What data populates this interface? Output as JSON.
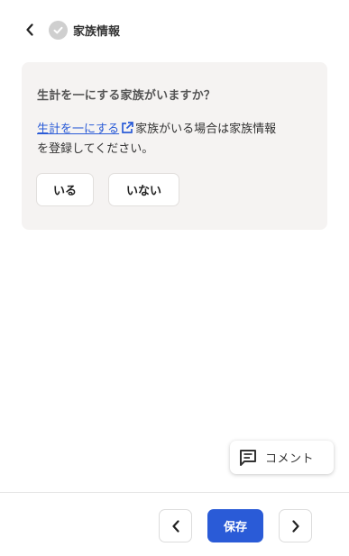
{
  "header": {
    "title": "家族情報",
    "back_icon": "chevron-left-icon",
    "status_icon": "check-circle-icon"
  },
  "card": {
    "question": "生計を一にする家族がいますか？",
    "link_text": "生計を一にする",
    "link_icon": "external-link-icon",
    "desc_line1_rest": "家族がいる場合は家族情報",
    "desc_line2": "を登録してください。",
    "yes_label": "いる",
    "no_label": "いない"
  },
  "comment": {
    "label": "コメント",
    "icon": "comment-icon"
  },
  "footer": {
    "save_label": "保存",
    "prev_icon": "chevron-left-icon",
    "next_icon": "chevron-right-icon"
  },
  "colors": {
    "accent": "#2a5bd7",
    "card_bg": "#f5f3f2",
    "check_gray": "#cfcfcf"
  }
}
